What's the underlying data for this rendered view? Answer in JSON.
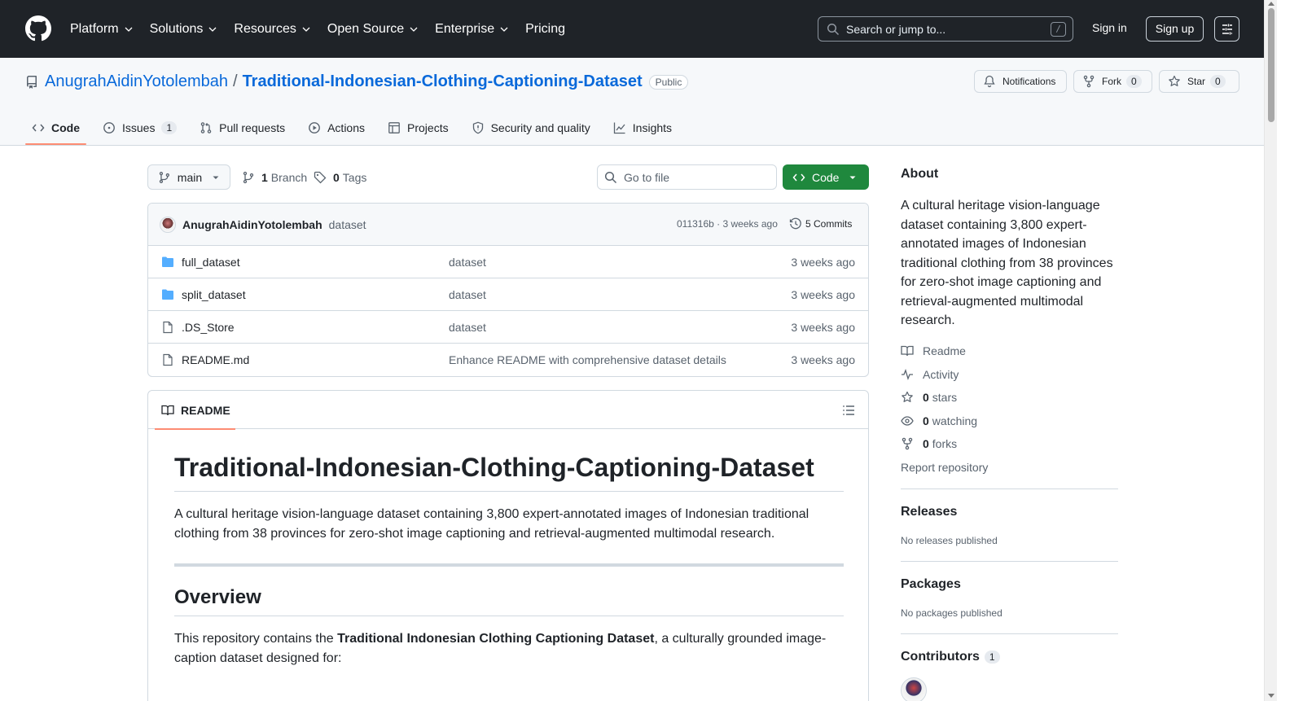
{
  "header": {
    "nav": [
      "Platform",
      "Solutions",
      "Resources",
      "Open Source",
      "Enterprise",
      "Pricing"
    ],
    "search_placeholder": "Search or jump to...",
    "search_shortcut": "/",
    "signin": "Sign in",
    "signup": "Sign up"
  },
  "repo": {
    "owner": "AnugrahAidinYotolembah",
    "separator": "/",
    "name": "Traditional-Indonesian-Clothing-Captioning-Dataset",
    "visibility": "Public",
    "notifications": "Notifications",
    "fork_label": "Fork",
    "fork_count": "0",
    "star_label": "Star",
    "star_count": "0"
  },
  "tabs": [
    {
      "label": "Code",
      "icon": "code-icon"
    },
    {
      "label": "Issues",
      "count": "1",
      "icon": "issue-icon"
    },
    {
      "label": "Pull requests",
      "icon": "pull-request-icon"
    },
    {
      "label": "Actions",
      "icon": "play-icon"
    },
    {
      "label": "Projects",
      "icon": "table-icon"
    },
    {
      "label": "Security and quality",
      "icon": "shield-icon"
    },
    {
      "label": "Insights",
      "icon": "graph-icon"
    }
  ],
  "toolbar": {
    "branch": "main",
    "branch_count": "1",
    "branch_label": "Branch",
    "tag_count": "0",
    "tag_label": "Tags",
    "goto_placeholder": "Go to file",
    "code_button": "Code"
  },
  "commit": {
    "author": "AnugrahAidinYotolembah",
    "message": "dataset",
    "meta": "011316b · 3 weeks ago",
    "commits": "5 Commits"
  },
  "files": [
    {
      "name": "full_dataset",
      "type": "folder",
      "message": "dataset",
      "date": "3 weeks ago"
    },
    {
      "name": "split_dataset",
      "type": "folder",
      "message": "dataset",
      "date": "3 weeks ago"
    },
    {
      "name": ".DS_Store",
      "type": "file",
      "message": "dataset",
      "date": "3 weeks ago"
    },
    {
      "name": "README.md",
      "type": "file",
      "message": "Enhance README with comprehensive dataset details",
      "date": "3 weeks ago"
    }
  ],
  "readme": {
    "tab": "README",
    "title": "Traditional-Indonesian-Clothing-Captioning-Dataset",
    "intro": "A cultural heritage vision-language dataset containing 3,800 expert-annotated images of Indonesian traditional clothing from 38 provinces for zero-shot image captioning and retrieval-augmented multimodal research.",
    "overview_heading": "Overview",
    "overview_pre": "This repository contains the ",
    "overview_bold": "Traditional Indonesian Clothing Captioning Dataset",
    "overview_post": ", a culturally grounded image-caption dataset designed for:"
  },
  "sidebar": {
    "about": "About",
    "description": "A cultural heritage vision-language dataset containing 3,800 expert-annotated images of Indonesian traditional clothing from 38 provinces for zero-shot image captioning and retrieval-augmented multimodal research.",
    "readme": "Readme",
    "activity": "Activity",
    "stars_count": "0",
    "stars_label": "stars",
    "watching_count": "0",
    "watching_label": "watching",
    "forks_count": "0",
    "forks_label": "forks",
    "report": "Report repository",
    "releases": "Releases",
    "releases_note": "No releases published",
    "packages": "Packages",
    "packages_note": "No packages published",
    "contributors": "Contributors",
    "contributors_count": "1"
  },
  "colors": {
    "header_bg": "#1f2328",
    "link": "#0969da",
    "primary_button": "#1f883d",
    "active_tab_underline": "#fd8c73"
  }
}
